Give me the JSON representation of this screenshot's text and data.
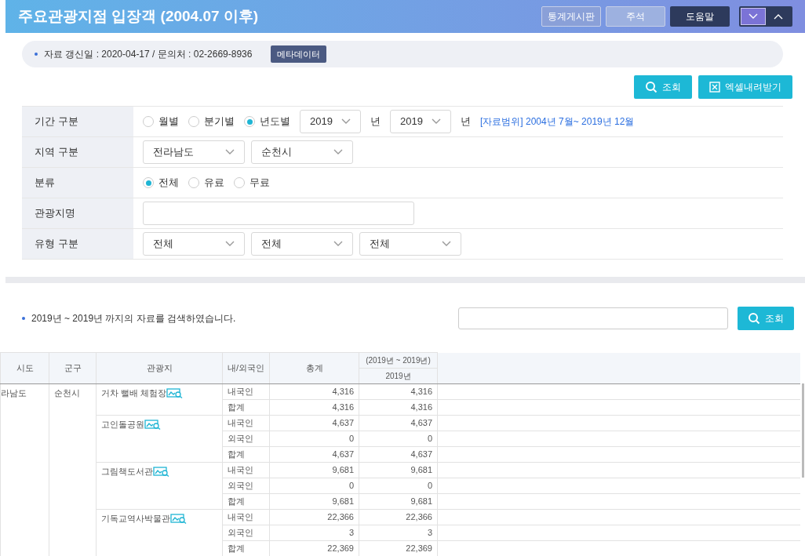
{
  "header": {
    "title": "주요관광지점 입장객 (2004.07 이후)",
    "buttons": [
      {
        "label": "통계게시판",
        "kind": "outline"
      },
      {
        "label": "주석",
        "kind": "light"
      },
      {
        "label": "도움말",
        "kind": "dark"
      }
    ],
    "toggles": [
      {
        "kind": "down",
        "selected": true
      },
      {
        "kind": "up",
        "selected": false
      }
    ]
  },
  "info": {
    "text": "자료 갱신일 : 2020-04-17 / 문의처 : 02-2669-8936",
    "badge": "메타데이터"
  },
  "actions": [
    {
      "label": "조회",
      "kind": "search"
    },
    {
      "label": "엑셀내려받기",
      "kind": "excel"
    }
  ],
  "form": [
    {
      "label": "기간 구분",
      "items": [
        {
          "kind": "radio",
          "label": "월별",
          "selected": false
        },
        {
          "kind": "radio",
          "label": "분기별",
          "selected": false
        },
        {
          "kind": "radio",
          "label": "년도별",
          "selected": true
        },
        {
          "kind": "year_select",
          "value": "2019"
        },
        {
          "kind": "text",
          "label": "년"
        },
        {
          "kind": "year_select",
          "value": "2019"
        },
        {
          "kind": "text",
          "label": "년"
        },
        {
          "kind": "note",
          "label": "[자료범위] 2004년 7월~ 2019년 12월"
        }
      ]
    },
    {
      "label": "지역 구분",
      "items": [
        {
          "kind": "select",
          "value": "전라남도"
        },
        {
          "kind": "select",
          "value": "순천시"
        }
      ]
    },
    {
      "label": "분류",
      "items": [
        {
          "kind": "radio",
          "label": "전체",
          "selected": true
        },
        {
          "kind": "radio",
          "label": "유료",
          "selected": false
        },
        {
          "kind": "radio",
          "label": "무료",
          "selected": false
        }
      ]
    },
    {
      "label": "관광지명",
      "items": [
        {
          "kind": "input"
        }
      ]
    },
    {
      "label": "유형 구분",
      "items": [
        {
          "kind": "select",
          "value": "전체"
        },
        {
          "kind": "select",
          "value": "전체"
        },
        {
          "kind": "select",
          "value": "전체"
        }
      ]
    }
  ],
  "result": {
    "summary": "2019년 ~ 2019년 까지의 자료를 검색하였습니다.",
    "search_button": "조회"
  },
  "table": {
    "columns": [
      "시도",
      "군구",
      "관광지",
      "내/외국인",
      "총계"
    ],
    "period_header": "(2019년 ~ 2019년)",
    "year_header": "2019년",
    "sido": "라남도",
    "gungu": "순천시",
    "spots": [
      {
        "name": "거차 뻘배 체험장",
        "rows": [
          {
            "type": "내국인",
            "total": "4,316",
            "year": "4,316"
          },
          {
            "type": "합계",
            "total": "4,316",
            "year": "4,316"
          }
        ]
      },
      {
        "name": "고인돌공원",
        "rows": [
          {
            "type": "내국인",
            "total": "4,637",
            "year": "4,637"
          },
          {
            "type": "외국인",
            "total": "0",
            "year": "0"
          },
          {
            "type": "합계",
            "total": "4,637",
            "year": "4,637"
          }
        ]
      },
      {
        "name": "그림책도서관",
        "rows": [
          {
            "type": "내국인",
            "total": "9,681",
            "year": "9,681"
          },
          {
            "type": "외국인",
            "total": "0",
            "year": "0"
          },
          {
            "type": "합계",
            "total": "9,681",
            "year": "9,681"
          }
        ]
      },
      {
        "name": "기독교역사박물관",
        "rows": [
          {
            "type": "내국인",
            "total": "22,366",
            "year": "22,366"
          },
          {
            "type": "외국인",
            "total": "3",
            "year": "3"
          },
          {
            "type": "합계",
            "total": "22,369",
            "year": "22,369"
          }
        ]
      }
    ]
  }
}
